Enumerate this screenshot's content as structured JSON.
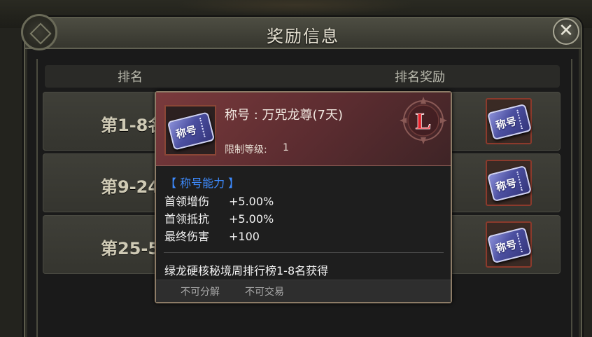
{
  "window": {
    "title": "奖励信息",
    "close_symbol": "✕"
  },
  "table": {
    "headers": [
      "排名",
      "排名奖励"
    ],
    "rows": [
      {
        "rank": "第1-8名",
        "reward_icon": "title-ticket-icon",
        "reward_label": "称号"
      },
      {
        "rank": "第9-24名",
        "reward_icon": "title-ticket-icon",
        "reward_label": "称号"
      },
      {
        "rank": "第25-50名",
        "reward_icon": "title-ticket-icon",
        "reward_label": "称号"
      }
    ]
  },
  "tooltip": {
    "icon": "title-ticket-icon",
    "icon_label": "称号",
    "title": "称号 : 万咒龙尊(7天)",
    "level_label": "限制等级:",
    "level_value": "1",
    "grade_letter": "L",
    "ability_title": "【 称号能力 】",
    "stats": [
      {
        "name": "首领增伤",
        "value": "+5.00%"
      },
      {
        "name": "首领抵抗",
        "value": "+5.00%"
      },
      {
        "name": "最终伤害",
        "value": "+100"
      }
    ],
    "source": "绿龙硬核秘境周排行榜1-8名获得",
    "tags": [
      "不可分解",
      "不可交易"
    ]
  },
  "colors": {
    "ability_title": "#3d8bff",
    "tooltip_header": "#7a3a3c",
    "grade_letter": "#e8202a",
    "slot_border": "#8c3a2c"
  }
}
